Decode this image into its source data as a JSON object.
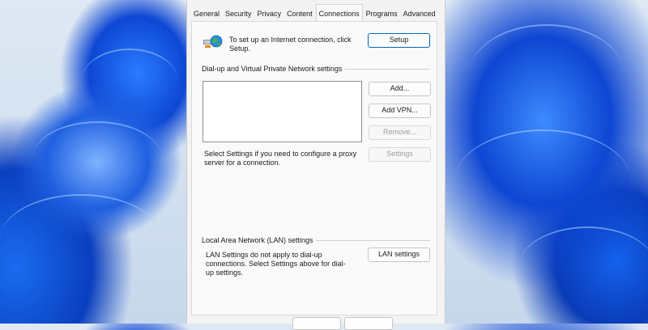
{
  "dialog": {
    "tabs": [
      "General",
      "Security",
      "Privacy",
      "Content",
      "Connections",
      "Programs",
      "Advanced"
    ],
    "active_tab": "Connections",
    "setup": {
      "icon": "network-globe-icon",
      "text": "To set up an Internet connection, click Setup.",
      "button": "Setup"
    },
    "dialup": {
      "heading": "Dial-up and Virtual Private Network settings",
      "add_button": "Add...",
      "add_vpn_button": "Add VPN...",
      "remove_button": "Remove...",
      "settings_text": "Select Settings if you need to configure a proxy server for a connection.",
      "settings_button": "Settings"
    },
    "lan": {
      "heading": "Local Area Network (LAN) settings",
      "text": "LAN Settings do not apply to dial-up connections. Select Settings above for dial-up settings.",
      "button": "LAN settings"
    }
  },
  "colors": {
    "accent": "#0067c0",
    "wallpaper_blue": "#1a5fe8",
    "dialog_bg": "#f3f3f3"
  }
}
